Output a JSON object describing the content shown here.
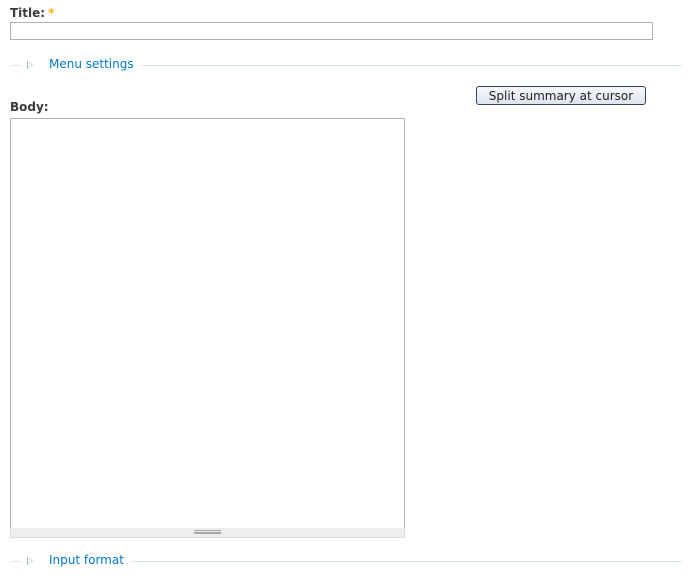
{
  "title_field": {
    "label": "Title:",
    "required_marker": "*",
    "value": ""
  },
  "menu_settings": {
    "label": "Menu settings",
    "collapsed": true
  },
  "split_button": {
    "label": "Split summary at cursor"
  },
  "body_field": {
    "label": "Body:",
    "value": ""
  },
  "input_format": {
    "label": "Input format",
    "collapsed": true
  },
  "colors": {
    "link": "#027ac6",
    "required": "#ffae00",
    "legend_line": "#dbe8ee"
  }
}
